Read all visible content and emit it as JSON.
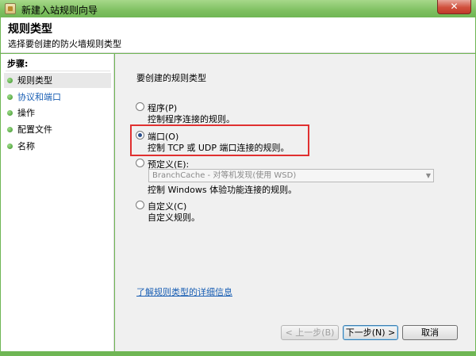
{
  "window": {
    "title": "新建入站规则向导",
    "close_label": "✕"
  },
  "header": {
    "title": "规则类型",
    "subtitle": "选择要创建的防火墙规则类型"
  },
  "nav": {
    "heading": "步骤:",
    "items": [
      {
        "label": "规则类型"
      },
      {
        "label": "协议和端口"
      },
      {
        "label": "操作"
      },
      {
        "label": "配置文件"
      },
      {
        "label": "名称"
      }
    ]
  },
  "content": {
    "question": "要创建的规则类型",
    "options": [
      {
        "label": "程序(P)",
        "description": "控制程序连接的规则。",
        "selected": false
      },
      {
        "label": "端口(O)",
        "description": "控制 TCP 或 UDP 端口连接的规则。",
        "selected": true
      },
      {
        "label": "预定义(E):",
        "description": "控制 Windows 体验功能连接的规则。",
        "selected": false
      },
      {
        "label": "自定义(C)",
        "description": "自定义规则。",
        "selected": false
      }
    ],
    "predefined_select_value": "BranchCache - 对等机发现(使用 WSD)",
    "learn_more_link": "了解规则类型的详细信息"
  },
  "buttons": {
    "back": "< 上一步(B)",
    "next": "下一步(N) >",
    "cancel": "取消"
  },
  "colors": {
    "accent_green": "#6fb654",
    "highlight_red": "#e03030",
    "link_blue": "#1a5fb4"
  }
}
